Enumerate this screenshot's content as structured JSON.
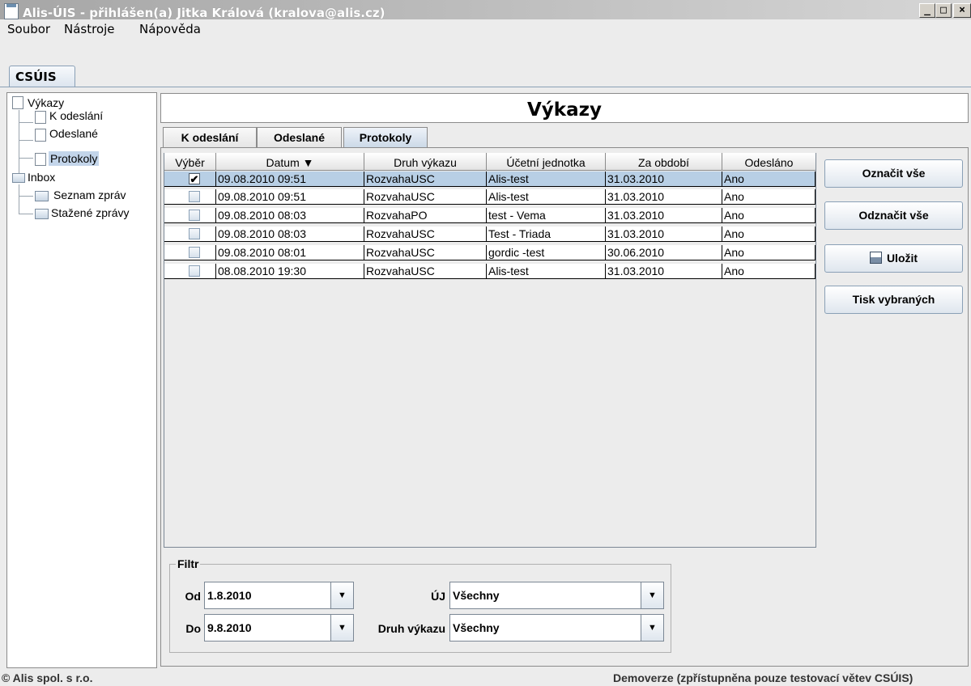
{
  "window": {
    "title": "Alis-ÚIS - přihlášen(a) Jitka Králová (kralova@alis.cz)",
    "controls": {
      "minimize": "_",
      "maximize": "□",
      "close": "×"
    }
  },
  "menu": [
    "Soubor",
    "Nástroje",
    "Nápověda"
  ],
  "top_tab": "CSÚIS",
  "tree": {
    "vykazy": "Výkazy",
    "k_odeslani": "K odeslání",
    "odeslane": "Odeslané",
    "protokoly": "Protokoly",
    "inbox": "Inbox",
    "seznam": "Seznam zpráv",
    "stazene": "Stažené zprávy"
  },
  "header": {
    "title": "Výkazy"
  },
  "tabs": [
    "K odeslání",
    "Odeslané",
    "Protokoly"
  ],
  "table": {
    "columns": [
      "Výběr",
      "Datum ▼",
      "Druh výkazu",
      "Účetní jednotka",
      "Za období",
      "Odesláno"
    ],
    "rows": [
      {
        "checked": "✔",
        "datum": "09.08.2010 09:51",
        "druh": "RozvahaUSC",
        "jednotka": "Alis-test",
        "obdobi": "31.03.2010",
        "odeslano": "Ano"
      },
      {
        "checked": "",
        "datum": "09.08.2010 09:51",
        "druh": "RozvahaUSC",
        "jednotka": "Alis-test",
        "obdobi": "31.03.2010",
        "odeslano": "Ano"
      },
      {
        "checked": "",
        "datum": "09.08.2010 08:03",
        "druh": "RozvahaPO",
        "jednotka": "test - Vema",
        "obdobi": "31.03.2010",
        "odeslano": "Ano"
      },
      {
        "checked": "",
        "datum": "09.08.2010 08:03",
        "druh": "RozvahaUSC",
        "jednotka": "Test - Triada",
        "obdobi": "31.03.2010",
        "odeslano": "Ano"
      },
      {
        "checked": "",
        "datum": "09.08.2010 08:01",
        "druh": "RozvahaUSC",
        "jednotka": "gordic -test",
        "obdobi": "30.06.2010",
        "odeslano": "Ano"
      },
      {
        "checked": "",
        "datum": "08.08.2010 19:30",
        "druh": "RozvahaUSC",
        "jednotka": "Alis-test",
        "obdobi": "31.03.2010",
        "odeslano": "Ano"
      }
    ]
  },
  "buttons": {
    "select_all": "Označit vše",
    "deselect_all": "Odznačit vše",
    "save": "Uložit",
    "print": "Tisk vybraných"
  },
  "filter": {
    "legend": "Filtr",
    "od_label": "Od",
    "od_value": "1.8.2010",
    "do_label": "Do",
    "do_value": "9.8.2010",
    "uj_label": "ÚJ",
    "uj_value": "Všechny",
    "druh_label": "Druh výkazu",
    "druh_value": "Všechny",
    "arrow": "▼"
  },
  "status": {
    "left": "© Alis spol. s r.o.",
    "right": "Demoverze (zpřístupněna pouze testovací větev CSÚIS)"
  }
}
